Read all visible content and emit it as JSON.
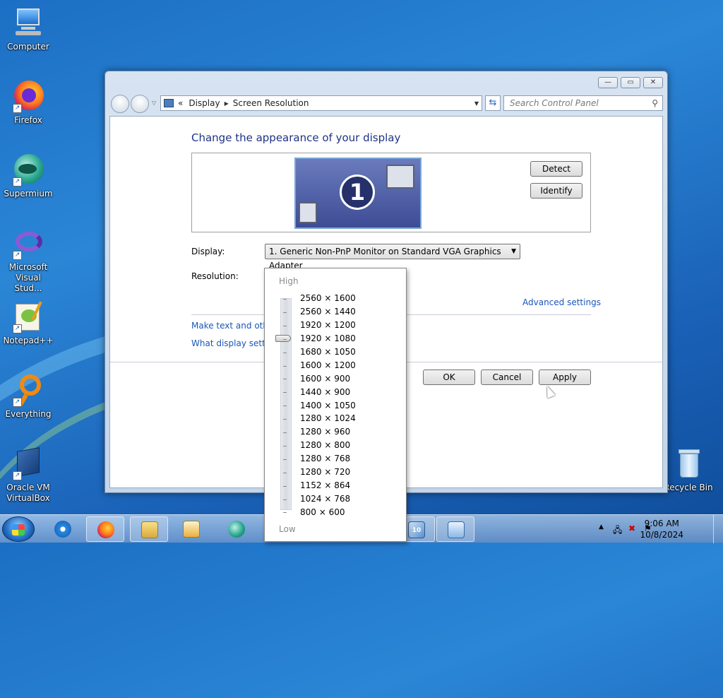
{
  "desktop": {
    "icons": [
      {
        "label": "Computer",
        "icon": "computer-icon"
      },
      {
        "label": "Firefox",
        "icon": "firefox-icon"
      },
      {
        "label": "Supermium",
        "icon": "supermium-icon"
      },
      {
        "label": "Microsoft Visual Stud...",
        "icon": "visual-studio-icon"
      },
      {
        "label": "Notepad++",
        "icon": "notepad-plus-plus-icon"
      },
      {
        "label": "Everything",
        "icon": "everything-search-icon"
      },
      {
        "label": "Oracle VM VirtualBox",
        "icon": "virtualbox-icon"
      },
      {
        "label": "Recycle Bin",
        "icon": "recycle-bin-icon"
      }
    ]
  },
  "window": {
    "breadcrumb": {
      "prefix": "«",
      "items": [
        "Display",
        "Screen Resolution"
      ]
    },
    "search_placeholder": "Search Control Panel",
    "heading": "Change the appearance of your display",
    "monitor_number": "1",
    "detect_label": "Detect",
    "identify_label": "Identify",
    "display_label": "Display:",
    "display_value": "1. Generic Non-PnP Monitor on Standard VGA Graphics Adapter",
    "resolution_label": "Resolution:",
    "advanced_settings": "Advanced settings",
    "link_text_size": "Make text and other",
    "link_display_settings": "What display setting",
    "ok_label": "OK",
    "cancel_label": "Cancel",
    "apply_label": "Apply"
  },
  "resolution_dropdown": {
    "high_label": "High",
    "low_label": "Low",
    "selected": "1920 × 1080",
    "options": [
      "2560 × 1600",
      "2560 × 1440",
      "1920 × 1200",
      "1920 × 1080",
      "1680 × 1050",
      "1600 × 1200",
      "1600 × 900",
      "1440 × 900",
      "1400 × 1050",
      "1280 × 1024",
      "1280 × 960",
      "1280 × 800",
      "1280 × 768",
      "1280 × 720",
      "1152 × 864",
      "1024 × 768",
      "800 × 600"
    ]
  },
  "taskbar": {
    "items": [
      "internet-explorer-icon",
      "firefox-icon",
      "file-explorer-icon",
      "media-player-icon",
      "supermium-icon",
      "windows-10-icon",
      "control-panel-icon"
    ],
    "time": "9:06 AM",
    "date": "10/8/2024"
  }
}
